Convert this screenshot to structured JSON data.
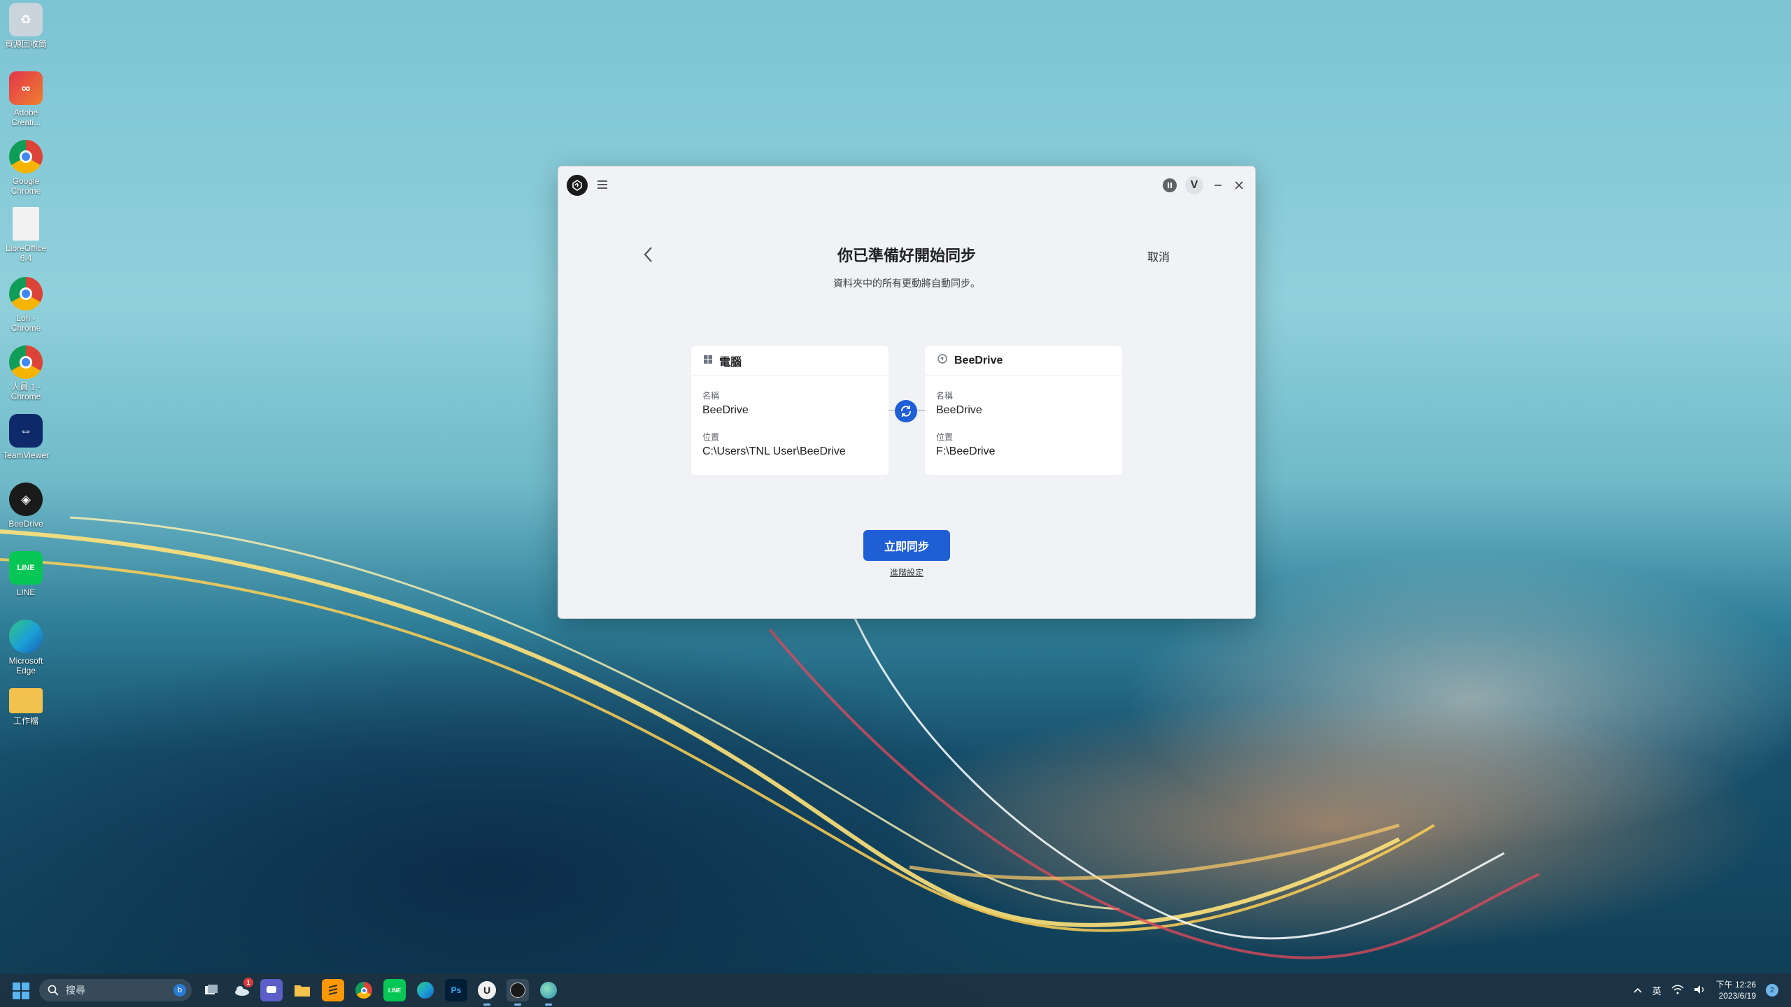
{
  "desktop": {
    "icons": [
      {
        "label": "資源回收筒",
        "icon": "recycle-bin-icon",
        "color": "#c9d4dc"
      },
      {
        "label": "Adobe Creati...",
        "icon": "adobe-creative-cloud-icon",
        "color": "#e2344a"
      },
      {
        "label": "Google Chrome",
        "icon": "chrome-icon",
        "color": "#ffffff"
      },
      {
        "label": "LibreOffice 6.4",
        "icon": "libreoffice-icon",
        "color": "#f2f2f2"
      },
      {
        "label": "Lori - Chrome",
        "icon": "chrome-profile-icon",
        "color": "#ffffff"
      },
      {
        "label": "人員 1 - Chrome",
        "icon": "chrome-profile-icon",
        "color": "#ffffff"
      },
      {
        "label": "TeamViewer",
        "icon": "teamviewer-icon",
        "color": "#0e2a6b"
      },
      {
        "label": "BeeDrive",
        "icon": "beedrive-icon",
        "color": "#1a1a1a"
      },
      {
        "label": "LINE",
        "icon": "line-icon",
        "color": "#06c755"
      },
      {
        "label": "Microsoft Edge",
        "icon": "edge-icon",
        "color": "#1aa0d8"
      },
      {
        "label": "工作檔",
        "icon": "folder-icon",
        "color": "#f2c14e"
      }
    ]
  },
  "app": {
    "title": "你已準備好開始同步",
    "subtitle": "資料夾中的所有更動將自動同步。",
    "cancel_label": "取消",
    "avatar_letter": "V",
    "local_card": {
      "header": "電腦",
      "name_label": "名稱",
      "name_value": "BeeDrive",
      "location_label": "位置",
      "location_value": "C:\\Users\\TNL User\\BeeDrive"
    },
    "remote_card": {
      "header": "BeeDrive",
      "name_label": "名稱",
      "name_value": "BeeDrive",
      "location_label": "位置",
      "location_value": "F:\\BeeDrive"
    },
    "sync_button_label": "立即同步",
    "advanced_link_label": "進階設定",
    "accent_color": "#1f5fd6"
  },
  "taskbar": {
    "search_placeholder": "搜尋",
    "apps": [
      {
        "name": "task-view",
        "glyph": ""
      },
      {
        "name": "weather",
        "glyph": ""
      },
      {
        "name": "teams-chat",
        "glyph": ""
      },
      {
        "name": "file-explorer",
        "glyph": ""
      },
      {
        "name": "sublime",
        "glyph": ""
      },
      {
        "name": "chrome",
        "glyph": ""
      },
      {
        "name": "line",
        "glyph": ""
      },
      {
        "name": "edge",
        "glyph": ""
      },
      {
        "name": "photoshop",
        "glyph": "Ps"
      },
      {
        "name": "app-u",
        "glyph": "U"
      },
      {
        "name": "beedrive",
        "glyph": ""
      },
      {
        "name": "globe",
        "glyph": ""
      }
    ],
    "weather_badge": "1",
    "ime_label": "英",
    "time": "下午 12:26",
    "date": "2023/6/19",
    "notification_count": "2"
  }
}
